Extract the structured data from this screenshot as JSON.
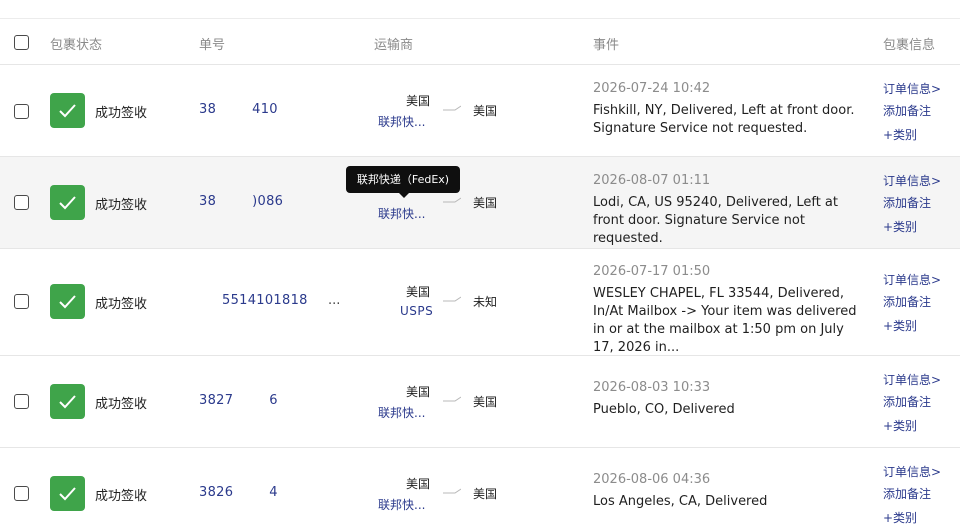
{
  "colors": {
    "success": "#3fa44a",
    "link": "#2b3a8c",
    "muted": "#8c8c8c",
    "tooltip_bg": "#0f0f0f"
  },
  "header": {
    "status": "包裹状态",
    "tracking": "单号",
    "carrier": "运输商",
    "event": "事件",
    "info": "包裹信息"
  },
  "tooltip": {
    "text": "联邦快递（FedEx)"
  },
  "rows": [
    {
      "status": "成功签收",
      "tracking_start": "38",
      "tracking_end": "410",
      "origin": "美国",
      "carrier": "联邦快...",
      "dest": "美国",
      "event_time": "2026-07-24 10:42",
      "event_desc": "Fishkill, NY, Delivered, Left at front door. Signature Service not requested.",
      "order_info": "订单信息>",
      "add_note": "添加备注",
      "category": "+类别"
    },
    {
      "status": "成功签收",
      "tracking_start": "38",
      "tracking_end": ")086",
      "origin": "美国",
      "carrier": "联邦快...",
      "dest": "美国",
      "event_time": "2026-08-07 01:11",
      "event_desc": "Lodi, CA, US 95240, Delivered, Left at front door. Signature Service not requested.",
      "order_info": "订单信息>",
      "add_note": "添加备注",
      "category": "+类别"
    },
    {
      "status": "成功签收",
      "tracking_start": "",
      "tracking_end": "5514101818",
      "tracking_ellipsis": "...",
      "origin": "美国",
      "carrier": "USPS",
      "dest": "未知",
      "event_time": "2026-07-17 01:50",
      "event_desc": "WESLEY CHAPEL, FL 33544, Delivered, In/At Mailbox -> Your item was delivered in or at the mailbox at 1:50 pm on July 17, 2026 in...",
      "order_info": "订单信息>",
      "add_note": "添加备注",
      "category": "+类别"
    },
    {
      "status": "成功签收",
      "tracking_start": "3827",
      "tracking_end": "6",
      "origin": "美国",
      "carrier": "联邦快...",
      "dest": "美国",
      "event_time": "2026-08-03 10:33",
      "event_desc": "Pueblo, CO, Delivered",
      "order_info": "订单信息>",
      "add_note": "添加备注",
      "category": "+类别"
    },
    {
      "status": "成功签收",
      "tracking_start": "3826",
      "tracking_end": "4",
      "origin": "美国",
      "carrier": "联邦快...",
      "dest": "美国",
      "event_time": "2026-08-06 04:36",
      "event_desc": "Los Angeles, CA, Delivered",
      "order_info": "订单信息>",
      "add_note": "添加备注",
      "category": "+类别"
    }
  ]
}
